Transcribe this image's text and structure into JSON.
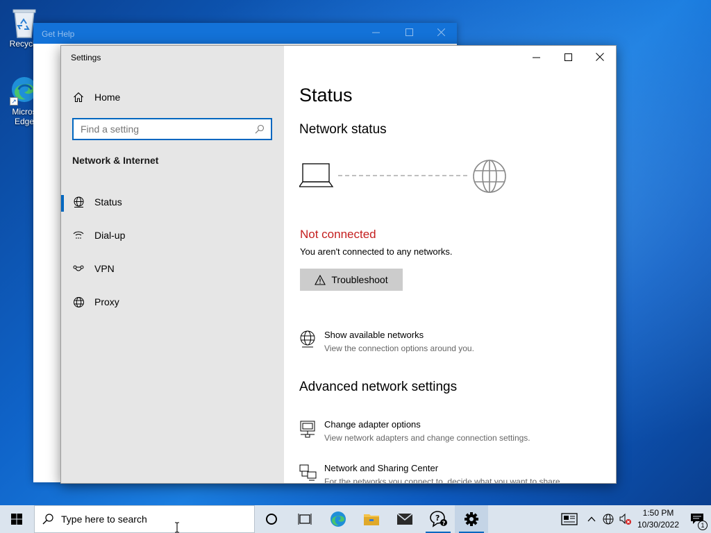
{
  "desktop": {
    "icons": [
      {
        "label": "Recycle"
      },
      {
        "label": "Micros Edge"
      }
    ]
  },
  "get_help_window": {
    "title": "Get Help"
  },
  "settings_window": {
    "app_title": "Settings",
    "sidebar": {
      "home_label": "Home",
      "search_placeholder": "Find a setting",
      "section_title": "Network & Internet",
      "items": [
        {
          "label": "Status",
          "icon": "globe-network-icon",
          "selected": true
        },
        {
          "label": "Dial-up",
          "icon": "dialup-icon",
          "selected": false
        },
        {
          "label": "VPN",
          "icon": "vpn-icon",
          "selected": false
        },
        {
          "label": "Proxy",
          "icon": "globe-icon",
          "selected": false
        }
      ]
    },
    "content": {
      "page_title": "Status",
      "network_status_heading": "Network status",
      "connection_state": "Not connected",
      "connection_desc": "You aren't connected to any networks.",
      "troubleshoot_label": "Troubleshoot",
      "show_networks": {
        "title": "Show available networks",
        "desc": "View the connection options around you."
      },
      "advanced_heading": "Advanced network settings",
      "adapter_options": {
        "title": "Change adapter options",
        "desc": "View network adapters and change connection settings."
      },
      "sharing_center": {
        "title": "Network and Sharing Center",
        "desc": "For the networks you connect to, decide what you want to share."
      }
    }
  },
  "taskbar": {
    "search_placeholder": "Type here to search",
    "apps": [
      "cortana-icon",
      "task-view-icon",
      "edge-icon",
      "file-explorer-icon",
      "mail-icon",
      "get-help-icon",
      "settings-icon"
    ],
    "clock_time": "1:50 PM",
    "clock_date": "10/30/2022",
    "notification_count": "1"
  },
  "colors": {
    "accent": "#0067c0",
    "error": "#c41e1e"
  }
}
